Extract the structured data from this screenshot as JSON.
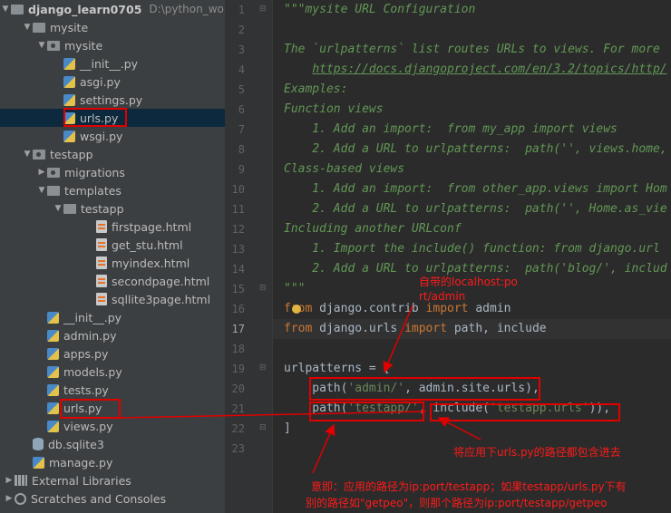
{
  "project": {
    "name": "django_learn0705",
    "path": "D:\\python_works"
  },
  "tree": [
    {
      "label": "mysite",
      "depth": 1,
      "type": "folder",
      "expanded": true
    },
    {
      "label": "mysite",
      "depth": 2,
      "type": "package",
      "expanded": true
    },
    {
      "label": "__init__.py",
      "depth": 3,
      "type": "py"
    },
    {
      "label": "asgi.py",
      "depth": 3,
      "type": "py"
    },
    {
      "label": "settings.py",
      "depth": 3,
      "type": "py"
    },
    {
      "label": "urls.py",
      "depth": 3,
      "type": "py",
      "selected": true,
      "boxed": true
    },
    {
      "label": "wsgi.py",
      "depth": 3,
      "type": "py"
    },
    {
      "label": "testapp",
      "depth": 1,
      "type": "package",
      "expanded": true
    },
    {
      "label": "migrations",
      "depth": 2,
      "type": "package",
      "expanded": false
    },
    {
      "label": "templates",
      "depth": 2,
      "type": "folder",
      "expanded": true
    },
    {
      "label": "testapp",
      "depth": 3,
      "type": "folder",
      "expanded": true
    },
    {
      "label": "firstpage.html",
      "depth": 4,
      "type": "html"
    },
    {
      "label": "get_stu.html",
      "depth": 4,
      "type": "html"
    },
    {
      "label": "myindex.html",
      "depth": 4,
      "type": "html"
    },
    {
      "label": "secondpage.html",
      "depth": 4,
      "type": "html"
    },
    {
      "label": "sqllite3page.html",
      "depth": 4,
      "type": "html"
    },
    {
      "label": "__init__.py",
      "depth": 2,
      "type": "py"
    },
    {
      "label": "admin.py",
      "depth": 2,
      "type": "py"
    },
    {
      "label": "apps.py",
      "depth": 2,
      "type": "py"
    },
    {
      "label": "models.py",
      "depth": 2,
      "type": "py"
    },
    {
      "label": "tests.py",
      "depth": 2,
      "type": "py"
    },
    {
      "label": "urls.py",
      "depth": 2,
      "type": "py",
      "boxed": true
    },
    {
      "label": "views.py",
      "depth": 2,
      "type": "py"
    },
    {
      "label": "db.sqlite3",
      "depth": 1,
      "type": "db"
    },
    {
      "label": "manage.py",
      "depth": 1,
      "type": "py"
    },
    {
      "label": "External Libraries",
      "depth": 0,
      "type": "lib",
      "expanded": false
    },
    {
      "label": "Scratches and Consoles",
      "depth": 0,
      "type": "scratch",
      "expanded": false
    }
  ],
  "editor": {
    "current_line": 17,
    "lines": [
      "\"\"\"mysite URL Configuration",
      "",
      "The `urlpatterns` list routes URLs to views. For more",
      "    https://docs.djangoproject.com/en/3.2/topics/http/",
      "Examples:",
      "Function views",
      "    1. Add an import:  from my_app import views",
      "    2. Add a URL to urlpatterns:  path('', views.home,",
      "Class-based views",
      "    1. Add an import:  from other_app.views import Hom",
      "    2. Add a URL to urlpatterns:  path('', Home.as_vie",
      "Including another URLconf",
      "    1. Import the include() function: from django.url",
      "    2. Add a URL to urlpatterns:  path('blog/', includ",
      "\"\"\"",
      "from django.contrib import admin",
      "from django.urls import path, include",
      "",
      "urlpatterns = [",
      "    path('admin/', admin.site.urls),",
      "    path('testapp/', include('testapp.urls')),",
      "]",
      ""
    ]
  },
  "annotations": {
    "admin_note_line1": "自带的localhost:po",
    "admin_note_line2": "rt/admin",
    "include_note": "将应用下urls.py的路径都包含进去",
    "meaning_line1": "意即：应用的路径为ip:port/testapp；如果testapp/urls.py下有",
    "meaning_line2": "别的路径如\"getpeo\"，则那个路径为ip:port/testapp/getpeo"
  },
  "colors": {
    "annotation": "#ff1a1a",
    "keyword": "#cc7832",
    "string": "#6a8759",
    "docstring": "#629755",
    "code": "#a9b7c6"
  }
}
